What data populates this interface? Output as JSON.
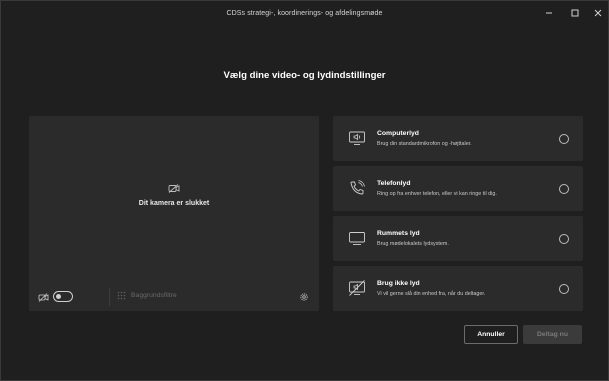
{
  "window": {
    "title": "CDSs strategi-, koordinerings- og afdelingsmøde",
    "controls": [
      "minimize",
      "maximize",
      "close"
    ]
  },
  "heading": "Vælg dine video- og lydindstillinger",
  "preview": {
    "camera_off_text": "Dit kamera er slukket",
    "camera_toggle_state": "off",
    "background_filters_label": "Baggrundsfiltre"
  },
  "audio_options": [
    {
      "title": "Computerlyd",
      "description": "Brug din standardmikrofon og -højttaler.",
      "icon": "computer-audio-icon",
      "selected": false
    },
    {
      "title": "Telefonlyd",
      "description": "Ring op fra enhver telefon, eller vi kan ringe til dig.",
      "icon": "phone-audio-icon",
      "selected": false
    },
    {
      "title": "Rummets lyd",
      "description": "Brug mødelokalets lydsystem.",
      "icon": "room-audio-icon",
      "selected": false
    },
    {
      "title": "Brug ikke lyd",
      "description": "Vi vil gerne slå din enhed fra, når du deltager.",
      "icon": "no-audio-icon",
      "selected": false
    }
  ],
  "buttons": {
    "cancel": "Annuller",
    "join": "Deltag nu"
  },
  "colors": {
    "background": "#1f1f1f",
    "panel": "#2b2b2b",
    "disabled_button": "#3b3b3b"
  }
}
